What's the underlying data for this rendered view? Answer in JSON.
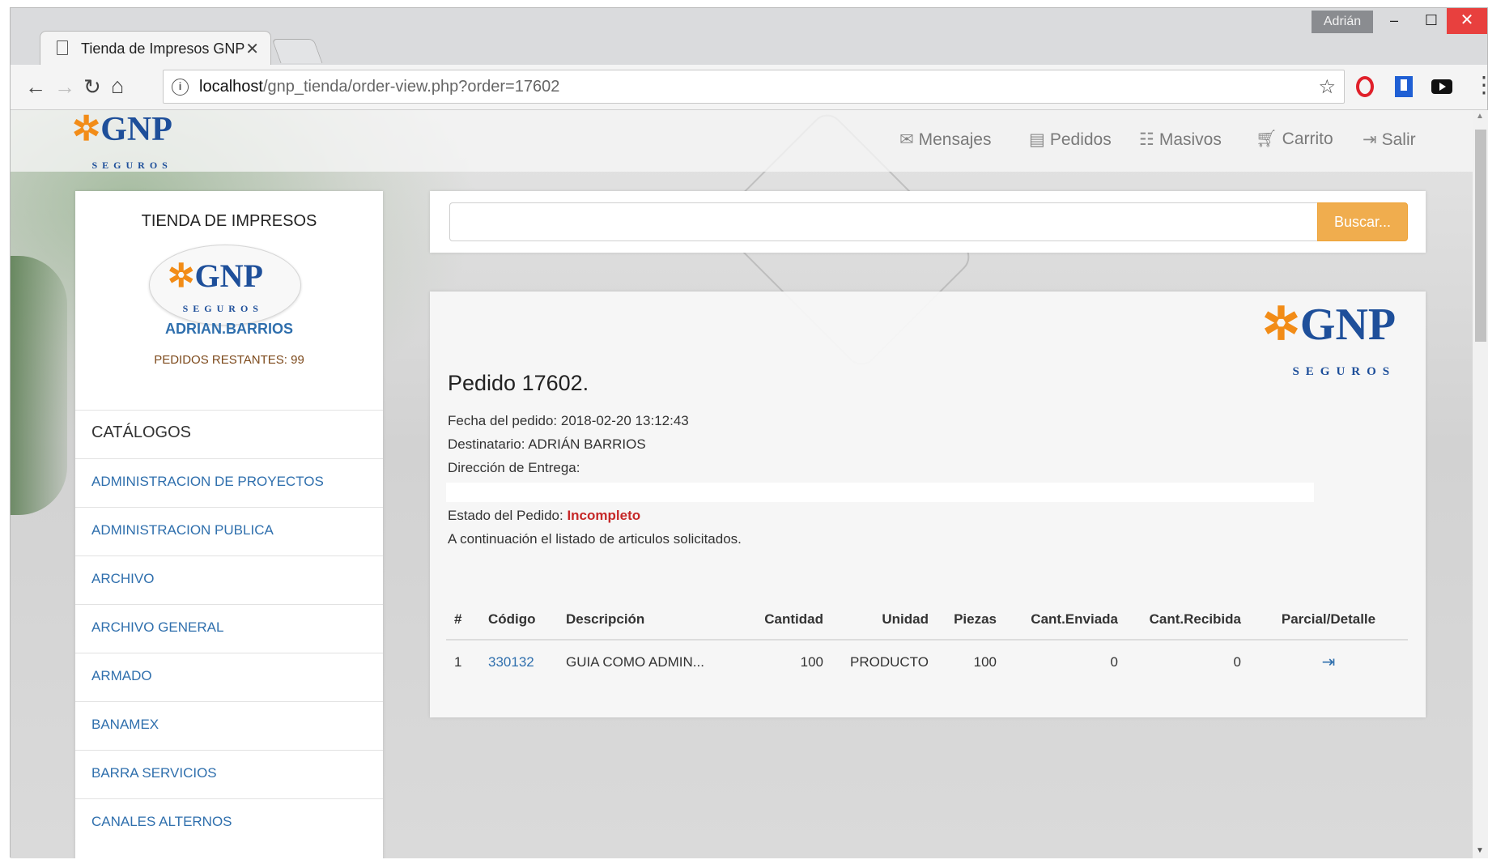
{
  "browser": {
    "profile_name": "Adrián",
    "tab_title": "Tienda de Impresos GNP",
    "url_host": "localhost",
    "url_path": "/gnp_tienda/order-view.php?order=17602"
  },
  "brand": {
    "logo_text": "GNP",
    "logo_subtext": "SEGUROS",
    "primary_color": "#1e4f9a",
    "accent_color": "#f28c17"
  },
  "topnav": {
    "items": [
      {
        "label": "Mensajes",
        "icon": "envelope-icon"
      },
      {
        "label": "Pedidos",
        "icon": "list-icon"
      },
      {
        "label": "Masivos",
        "icon": "th-list-icon"
      },
      {
        "label": "Carrito",
        "icon": "cart-icon"
      },
      {
        "label": "Salir",
        "icon": "logout-icon"
      }
    ]
  },
  "sidebar": {
    "title": "TIENDA DE IMPRESOS",
    "username": "ADRIAN.BARRIOS",
    "remaining": "PEDIDOS RESTANTES: 99",
    "catalog_header": "CATÁLOGOS",
    "catalogs": [
      "ADMINISTRACION DE PROYECTOS",
      "ADMINISTRACION PUBLICA",
      "ARCHIVO",
      "ARCHIVO GENERAL",
      "ARMADO",
      "BANAMEX",
      "BARRA SERVICIOS",
      "CANALES ALTERNOS"
    ]
  },
  "search": {
    "placeholder": "",
    "button_label": "Buscar..."
  },
  "order": {
    "title": "Pedido 17602.",
    "date_line": "Fecha del pedido: 2018-02-20 13:12:43",
    "recipient_line": "Destinatario: ADRIÁN BARRIOS",
    "address_label": "Dirección de Entrega:",
    "status_label": "Estado del Pedido:",
    "status_value": "Incompleto",
    "status_color": "#c62828",
    "list_intro": "A continuación el listado de articulos solicitados.",
    "columns": [
      "#",
      "Código",
      "Descripción",
      "Cantidad",
      "Unidad",
      "Piezas",
      "Cant.Enviada",
      "Cant.Recibida",
      "Parcial/Detalle"
    ],
    "rows": [
      {
        "num": "1",
        "code": "330132",
        "description": "GUIA COMO ADMIN...",
        "quantity": "100",
        "unit": "PRODUCTO",
        "pieces": "100",
        "sent": "0",
        "received": "0",
        "detail_icon": "log-in-icon"
      }
    ]
  }
}
